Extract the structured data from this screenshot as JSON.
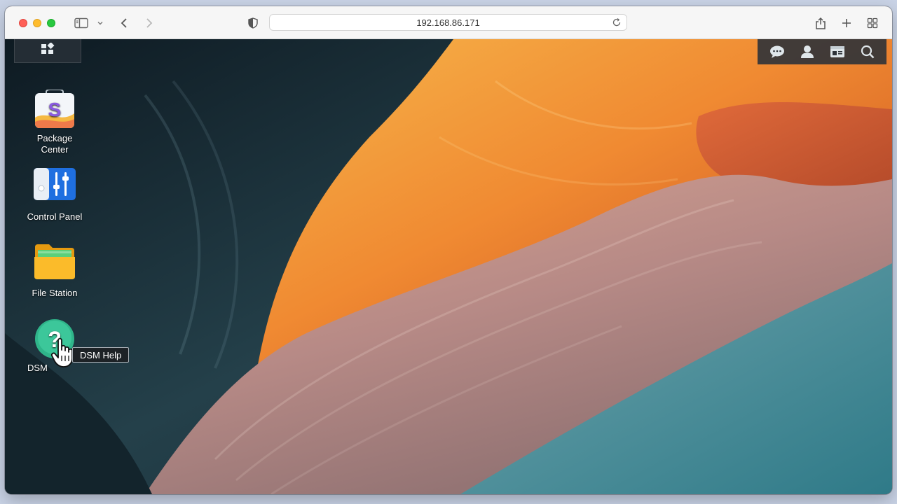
{
  "browser": {
    "url": "192.168.86.171"
  },
  "toolbar_icons": {
    "sidebar": "sidebar-icon",
    "back": "chevron-left-icon",
    "forward": "chevron-right-icon",
    "privacy": "shield-icon",
    "share": "share-icon",
    "new_tab": "plus-icon",
    "tab_overview": "grid-icon"
  },
  "dsm": {
    "top_icons": [
      "chat-icon",
      "user-icon",
      "widgets-icon",
      "search-icon"
    ],
    "desktop_icons": [
      {
        "label_line1": "Package",
        "label_line2": "Center",
        "icon": "package-center-icon"
      },
      {
        "label_line1": "Control Panel",
        "label_line2": "",
        "icon": "control-panel-icon"
      },
      {
        "label_line1": "File Station",
        "label_line2": "",
        "icon": "file-station-icon"
      },
      {
        "label_line1": "DSM",
        "label_line2": "",
        "icon": "dsm-help-icon"
      }
    ],
    "tooltip": "DSM Help"
  },
  "colors": {
    "help_green": "#2fb58a",
    "canyon_orange": "#f08a32",
    "canyon_dark": "#1d2f38"
  }
}
